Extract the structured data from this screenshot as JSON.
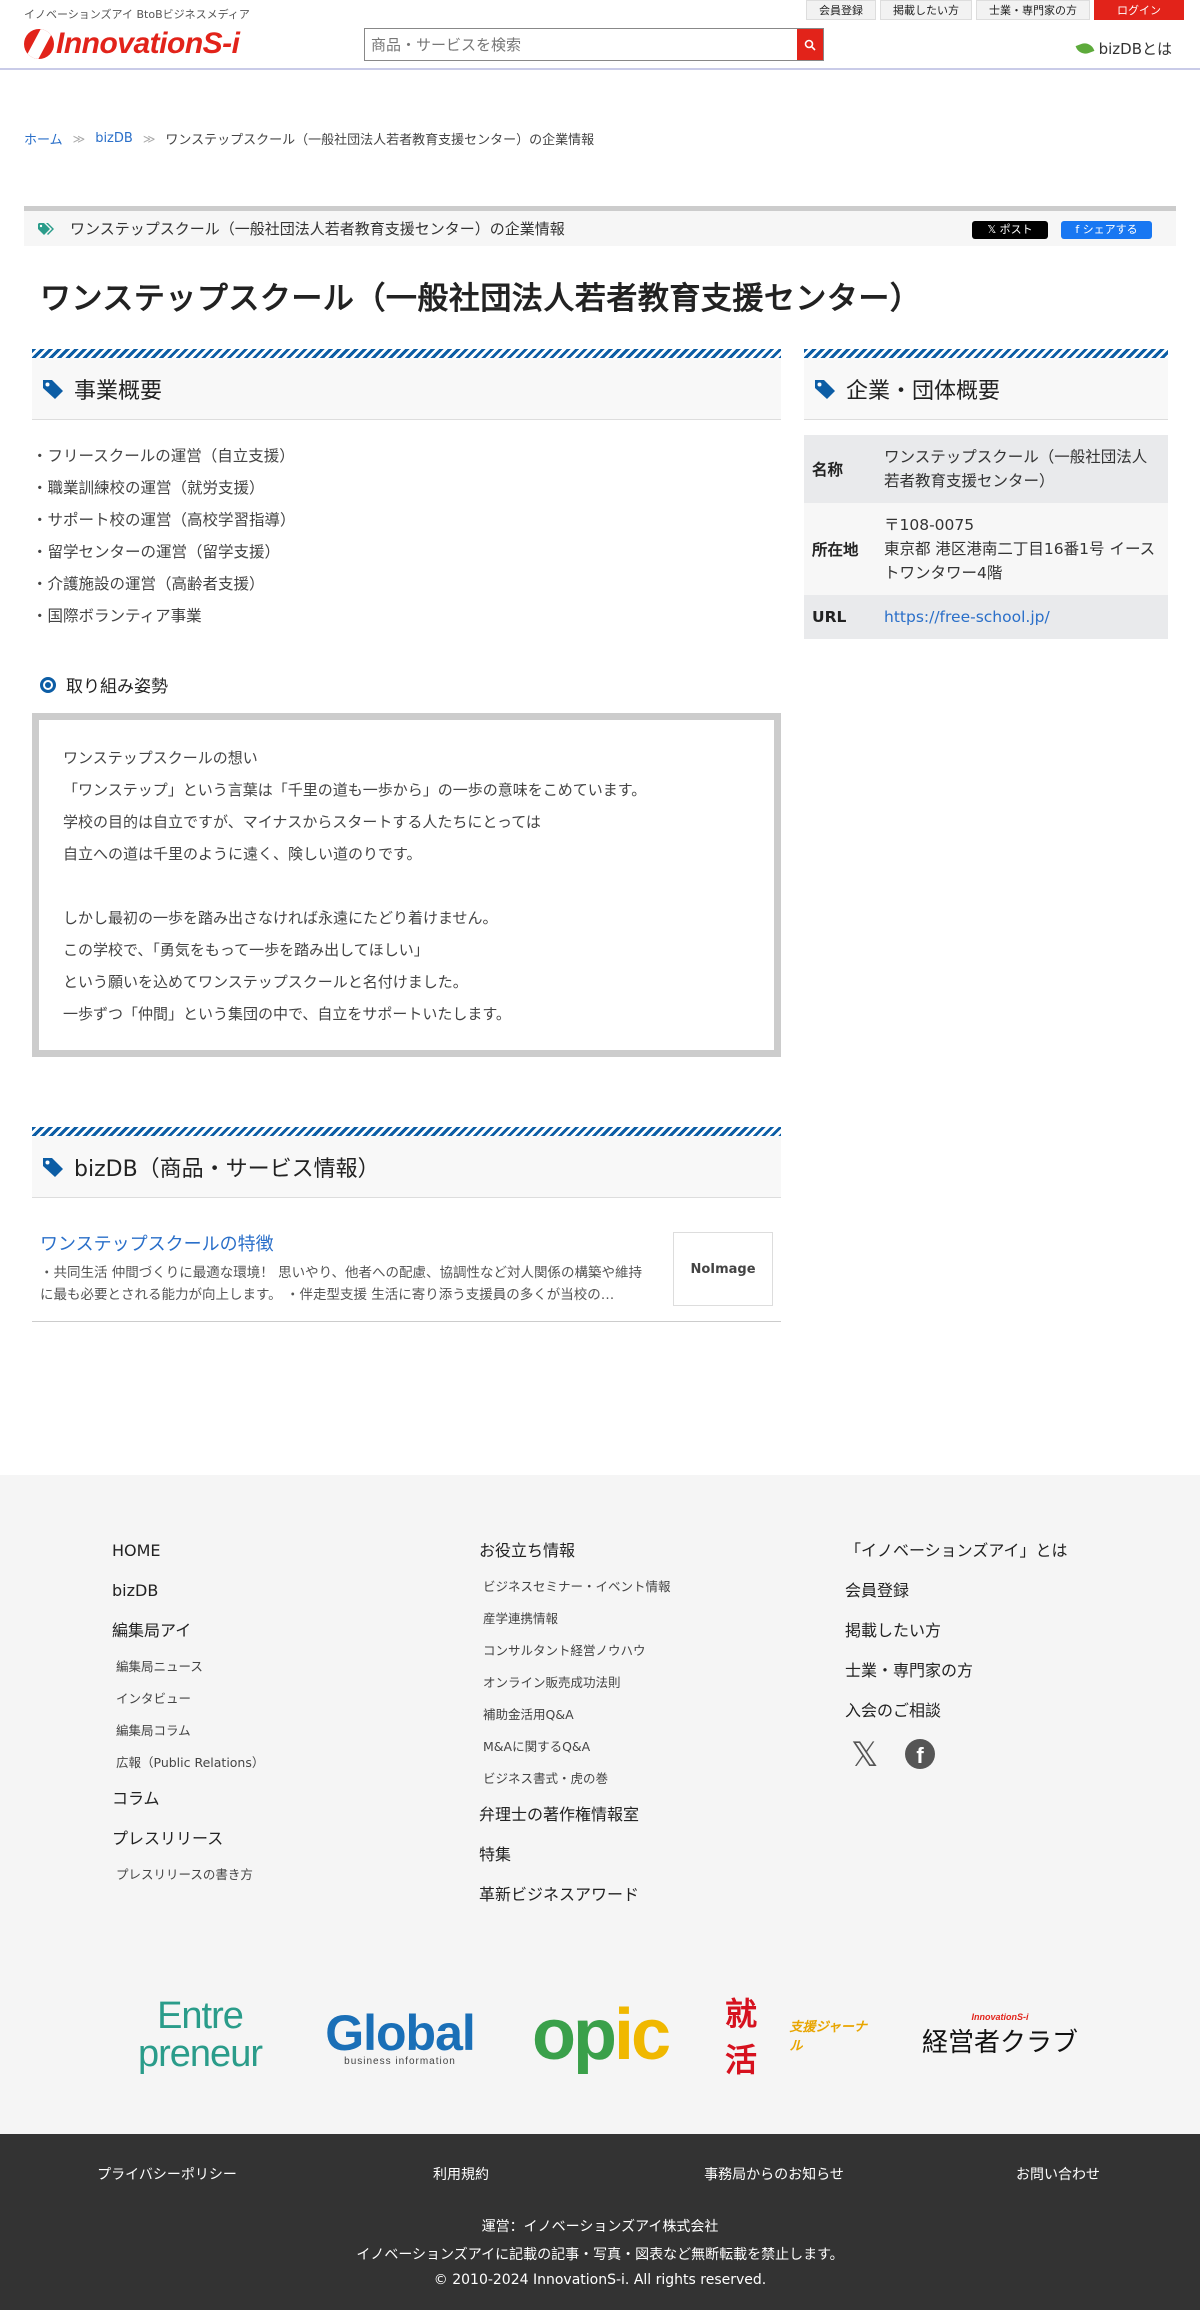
{
  "header": {
    "tagline": "イノベーションズアイ BtoBビジネスメディア",
    "logo_text": "InnovationS-i",
    "search_placeholder": "商品・サービスを検索",
    "search_icon": "search-icon",
    "topnav": [
      "会員登録",
      "掲載したい方",
      "士業・専門家の方",
      "ログイン"
    ],
    "bizdb_about": "bizDBとは"
  },
  "breadcrumb": {
    "items": [
      "ホーム",
      "bizDB"
    ],
    "current": "ワンステップスクール（一般社団法人若者教育支援センター）の企業情報"
  },
  "page": {
    "heading": "ワンステップスクール（一般社団法人若者教育支援センター）の企業情報",
    "share_x": "𝕏 ポスト",
    "share_fb": "f シェアする",
    "company_name": "ワンステップスクール（一般社団法人若者教育支援センター）"
  },
  "business": {
    "title": "事業概要",
    "items": [
      "・フリースクールの運営（自立支援）",
      "・職業訓練校の運営（就労支援）",
      "・サポート校の運営（高校学習指導）",
      "・留学センターの運営（留学支援）",
      "・介護施設の運営（高齢者支援）",
      "・国際ボランティア事業"
    ],
    "approach_title": "取り組み姿勢",
    "approach_lines": [
      "ワンステップスクールの想い",
      "「ワンステップ」という言葉は「千里の道も一歩から」の一歩の意味をこめています。",
      "学校の目的は自立ですが、マイナスからスタートする人たちにとっては",
      "自立への道は千里のように遠く、険しい道のりです。",
      "",
      "しかし最初の一歩を踏み出さなければ永遠にたどり着けません。",
      "この学校で、「勇気をもって一歩を踏み出してほしい」",
      "という願いを込めてワンステップスクールと名付けました。",
      "一歩ずつ「仲間」という集団の中で、自立をサポートいたします。"
    ]
  },
  "profile": {
    "title": "企業・団体概要",
    "rows": [
      {
        "label": "名称",
        "value": "ワンステップスクール（一般社団法人若者教育支援センター）"
      },
      {
        "label": "所在地",
        "value": "〒108-0075\n東京都 港区港南二丁目16番1号 イーストワンタワー4階"
      },
      {
        "label": "URL",
        "value": "https://free-school.jp/"
      }
    ]
  },
  "bizdb": {
    "title": "bizDB（商品・サービス情報）",
    "card_title": "ワンステップスクールの特徴",
    "card_desc": "・共同生活 仲間づくりに最適な環境！ 思いやり、他者への配慮、協調性など対人関係の構築や維持に最も必要とされる能力が向上します。 ・伴走型支援 生活に寄り添う支援員の多くが当校の…",
    "noimage": "NoImage"
  },
  "footer": {
    "col1": [
      {
        "t": "HOME",
        "sub": []
      },
      {
        "t": "bizDB",
        "sub": []
      },
      {
        "t": "編集局アイ",
        "sub": [
          "編集局ニュース",
          "インタビュー",
          "編集局コラム",
          "広報（Public Relations）"
        ]
      },
      {
        "t": "コラム",
        "sub": []
      },
      {
        "t": "プレスリリース",
        "sub": [
          "プレスリリースの書き方"
        ]
      }
    ],
    "col2": [
      {
        "t": "お役立ち情報",
        "sub": [
          "ビジネスセミナー・イベント情報",
          "産学連携情報",
          "コンサルタント経営ノウハウ",
          "オンライン販売成功法則",
          "補助金活用Q&A",
          "M&Aに関するQ&A",
          "ビジネス書式・虎の巻"
        ]
      },
      {
        "t": "弁理士の著作権情報室",
        "sub": []
      },
      {
        "t": "特集",
        "sub": []
      },
      {
        "t": "革新ビジネスアワード",
        "sub": []
      }
    ],
    "col3": [
      "「イノベーションズアイ」とは",
      "会員登録",
      "掲載したい方",
      "士業・専門家の方",
      "入会のご相談"
    ],
    "social": {
      "x": "𝕏",
      "fb": "f"
    },
    "brands": {
      "entre1": "Entre",
      "entre2": "preneur",
      "global": "Global",
      "global_sub": "business information",
      "opic_o": "op",
      "opic_i": "ic",
      "shu": "就活",
      "shu_sub": "支援ジャーナル",
      "club_sub": "InnovationS-i",
      "club": "経営者クラブ"
    },
    "bottom_links": [
      "プライバシーポリシー",
      "利用規約",
      "事務局からのお知らせ",
      "お問い合わせ"
    ],
    "operator": "運営：イノベーションズアイ株式会社",
    "notice": "イノベーションズアイに記載の記事・写真・図表など無断転載を禁止します。",
    "copyright": "© 2010-2024 InnovationS-i. All rights reserved."
  },
  "colors": {
    "brand_red": "#e2231a",
    "accent_blue": "#0c5da5",
    "link_blue": "#2a6fc9"
  }
}
